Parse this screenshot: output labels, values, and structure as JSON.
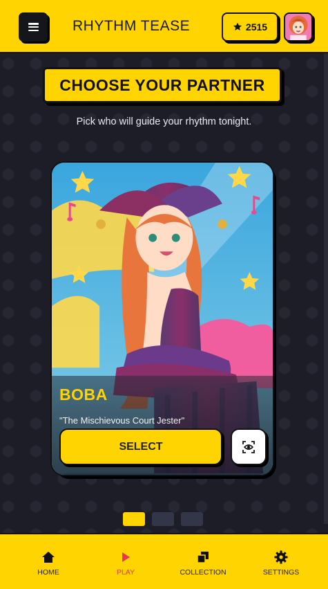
{
  "header": {
    "title": "RHYTHM TEASE",
    "coins": "2515",
    "coin_icon": "star-badge-icon",
    "menu_icon": "hamburger-menu-icon"
  },
  "main": {
    "heading": "CHOOSE YOUR PARTNER",
    "subheading": "Pick who will guide your rhythm tonight."
  },
  "card": {
    "name": "BOBA",
    "tagline": "\"The Mischievous Court Jester\"",
    "select_label": "SELECT",
    "preview_icon": "eye-preview-icon"
  },
  "carousel": {
    "active_index": 0,
    "count": 3
  },
  "nav": {
    "items": [
      {
        "label": "HOME",
        "icon": "home-icon"
      },
      {
        "label": "PLAY",
        "icon": "play-icon"
      },
      {
        "label": "COLLECTION",
        "icon": "collection-icon"
      },
      {
        "label": "SETTINGS",
        "icon": "gear-icon"
      }
    ],
    "active": "PLAY"
  },
  "colors": {
    "accent": "#ffd400",
    "background": "#1c1d26",
    "active_nav": "#e5384f"
  }
}
